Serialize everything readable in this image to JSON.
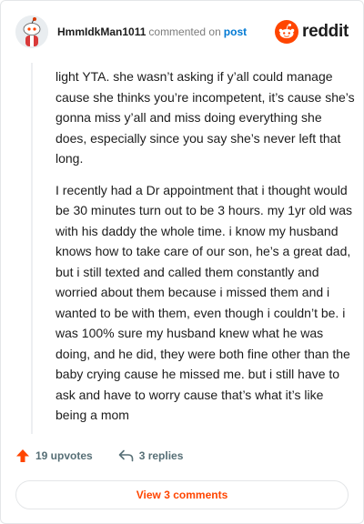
{
  "header": {
    "username": "HmmIdkMan1011",
    "action_text": "commented on",
    "post_link": "post",
    "brand_name": "reddit",
    "brand_color": "#ff4500"
  },
  "comment": {
    "paragraphs": [
      "light YTA. she wasn’t asking if y’all could manage cause she thinks you’re incompetent, it’s cause she’s gonna miss y’all and miss doing everything she does, especially since you say she’s never left that long.",
      "I recently had a Dr appointment that i thought would be 30 minutes turn out to be 3 hours. my 1yr old was with his daddy the whole time. i know my husband knows how to take care of our son, he’s a great dad, but i still texted and called them constantly and worried about them because i missed them and i wanted to be with them, even though i couldn’t be. i was 100% sure my husband knew what he was doing, and he did, they were both fine other than the baby crying cause he missed me. but i still have to ask and have to worry cause that’s what it’s like being a mom"
    ]
  },
  "actions": {
    "upvotes": "19 upvotes",
    "replies": "3 replies",
    "upvote_icon": "upvote-arrow-icon",
    "reply_icon": "reply-arrow-icon"
  },
  "footer": {
    "view_comments": "View 3 comments"
  }
}
